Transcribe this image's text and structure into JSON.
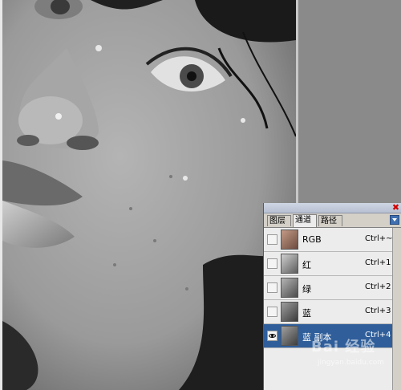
{
  "panel": {
    "tabs": [
      {
        "label": "图层",
        "active": false
      },
      {
        "label": "通道",
        "active": true
      },
      {
        "label": "路径",
        "active": false
      }
    ],
    "channels": [
      {
        "name": "RGB",
        "shortcut": "Ctrl+~",
        "visible": false,
        "selected": false,
        "thumb_color": "#8b6f60"
      },
      {
        "name": "红",
        "shortcut": "Ctrl+1",
        "visible": false,
        "selected": false,
        "thumb_color": "#a9a9a9"
      },
      {
        "name": "绿",
        "shortcut": "Ctrl+2",
        "visible": false,
        "selected": false,
        "thumb_color": "#8f8f8f"
      },
      {
        "name": "蓝",
        "shortcut": "Ctrl+3",
        "visible": false,
        "selected": false,
        "thumb_color": "#707070"
      },
      {
        "name": "蓝 副本",
        "shortcut": "Ctrl+4",
        "visible": true,
        "selected": true,
        "thumb_color": "#737373"
      }
    ],
    "close_glyph": "✖"
  },
  "watermark": {
    "text": "Bai 经验",
    "subtext": "jingyan.baidu.com"
  },
  "colors": {
    "selected_row": "#2f5e9a",
    "workspace": "#8a8a8a"
  },
  "icons": {
    "eye": "eye-icon",
    "close": "close-icon",
    "menu": "panel-menu-icon"
  }
}
